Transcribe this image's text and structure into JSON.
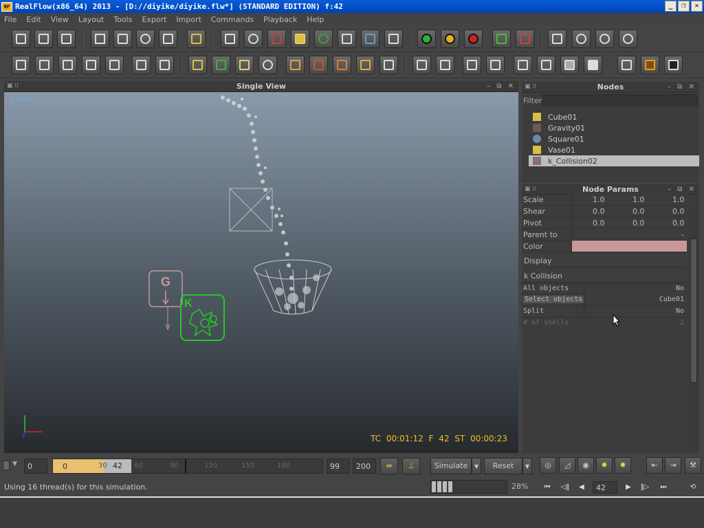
{
  "window": {
    "title": "RealFlow(x86_64) 2013 - [D://diyike/diyike.flw*] (STANDARD EDITION) f:42",
    "icon_text": "RF",
    "buttons": [
      "_",
      "❐",
      "✕"
    ]
  },
  "menu": [
    "File",
    "Edit",
    "View",
    "Layout",
    "Tools",
    "Export",
    "Import",
    "Commands",
    "Playback",
    "Help"
  ],
  "viewport": {
    "title": "Single View",
    "camera_label": "persp",
    "info": "TC 00:01:12   F 42   ST 00:00:23"
  },
  "nodes_panel": {
    "title": "Nodes",
    "filter_label": "Filter",
    "items": [
      {
        "label": "Cube01",
        "icon": "cube-icon",
        "color": "#d8c040"
      },
      {
        "label": "Gravity01",
        "icon": "gravity-icon",
        "color": "#8a7070"
      },
      {
        "label": "Square01",
        "icon": "emitter-icon",
        "color": "#6a8ab0"
      },
      {
        "label": "Vase01",
        "icon": "object-icon",
        "color": "#d8c040"
      },
      {
        "label": "k_Collision02",
        "icon": "collision-icon",
        "color": "#8a7070"
      }
    ]
  },
  "node_params": {
    "title": "Node Params",
    "rows": [
      {
        "label": "Scale",
        "values": [
          "1.0",
          "1.0",
          "1.0"
        ]
      },
      {
        "label": "Shear",
        "values": [
          "0.0",
          "0.0",
          "0.0"
        ]
      },
      {
        "label": "Pivot",
        "values": [
          "0.0",
          "0.0",
          "0.0"
        ]
      },
      {
        "label": "Parent to",
        "value": "-"
      },
      {
        "label": "Color",
        "swatch": "#c89898"
      }
    ],
    "sections": [
      "Display",
      "k Collision"
    ],
    "collision_rows": [
      {
        "label": "All objects",
        "value": "No"
      },
      {
        "label": "Select objects",
        "value": "Cube01"
      },
      {
        "label": "Split",
        "value": "No"
      },
      {
        "label": "# of shells",
        "value": "2"
      }
    ]
  },
  "timeline": {
    "start": "0",
    "range_start": "0",
    "current": "42",
    "ticks": [
      "30",
      "60",
      "90",
      "120",
      "150",
      "180"
    ],
    "end": "99",
    "max": "200",
    "simulate": "Simulate",
    "reset": "Reset"
  },
  "status": {
    "message": "Using 16 thread(s) for this simulation.",
    "progress": "28%",
    "progress_value": 0.28,
    "frame": "42"
  }
}
